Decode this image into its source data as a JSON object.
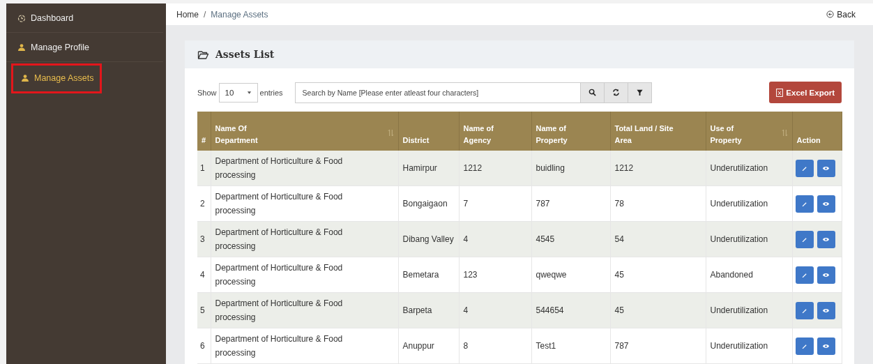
{
  "sidebar": {
    "items": [
      {
        "label": "Dashboard",
        "kind": "dashboard",
        "selected": false,
        "highlighted": false
      },
      {
        "label": "Manage Profile",
        "kind": "page",
        "selected": false,
        "highlighted": false
      },
      {
        "label": "Manage Assets",
        "kind": "page",
        "selected": true,
        "highlighted": true
      }
    ]
  },
  "breadcrumb": [
    "Home",
    "Manage Assets"
  ],
  "breadcrumb_separator": "/",
  "back_link": "Back",
  "panel": {
    "title": "Assets List",
    "length_control": {
      "prefix": "Show",
      "value": "10",
      "suffix": "entries"
    },
    "search": {
      "placeholder": "Search by Name [Please enter atleast four characters]"
    },
    "export_button": "Excel Export",
    "table": {
      "columns": [
        {
          "label": "#",
          "sortable": false
        },
        {
          "label": "Name Of Department",
          "sortable": true
        },
        {
          "label": "District",
          "sortable": false
        },
        {
          "label": "Name of Agency",
          "sortable": false
        },
        {
          "label": "Name of Property",
          "sortable": false
        },
        {
          "label": "Total Land / Site Area",
          "sortable": false
        },
        {
          "label": "Use of Property",
          "sortable": true
        },
        {
          "label": "Action",
          "sortable": false
        }
      ],
      "rows": [
        [
          "1",
          "Department of Horticulture & Food processing",
          "Hamirpur",
          "1212",
          "buidling",
          "1212",
          "Underutilization"
        ],
        [
          "2",
          "Department of Horticulture & Food processing",
          "Bongaigaon",
          "7",
          "787",
          "78",
          "Underutilization"
        ],
        [
          "3",
          "Department of Horticulture & Food processing",
          "Dibang Valley",
          "4",
          "4545",
          "54",
          "Underutilization"
        ],
        [
          "4",
          "Department of Horticulture & Food processing",
          "Bemetara",
          "123",
          "qweqwe",
          "45",
          "Abandoned"
        ],
        [
          "5",
          "Department of Horticulture & Food processing",
          "Barpeta",
          "4",
          "544654",
          "45",
          "Underutilization"
        ],
        [
          "6",
          "Department of Horticulture & Food processing",
          "Anuppur",
          "8",
          "Test1",
          "787",
          "Underutilization"
        ]
      ]
    }
  }
}
